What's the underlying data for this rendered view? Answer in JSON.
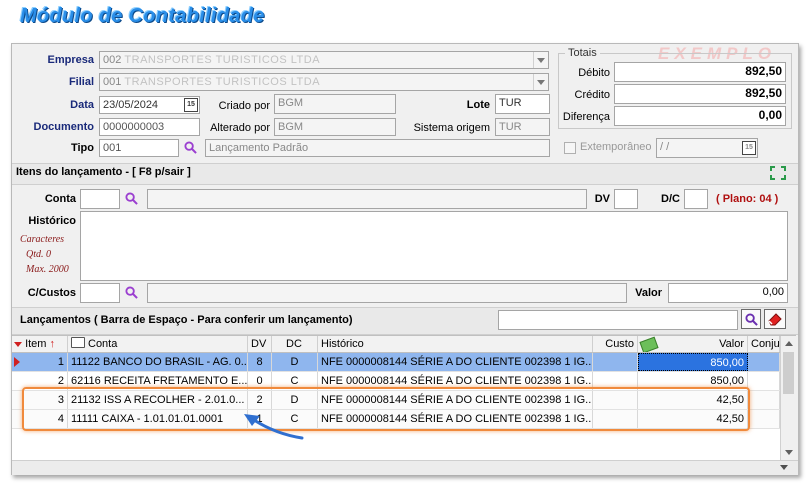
{
  "app": {
    "title": "Módulo de Contabilidade",
    "watermark": "EXEMPLO"
  },
  "header": {
    "empresa": {
      "label": "Empresa",
      "value": "002",
      "masked": "TRANSPORTES TURISTICOS LTDA"
    },
    "filial": {
      "label": "Filial",
      "value": "001",
      "masked": "TRANSPORTES TURISTICOS LTDA"
    },
    "data": {
      "label": "Data",
      "value": "23/05/2024"
    },
    "criado_por": {
      "label": "Criado por",
      "value": "BGM"
    },
    "lote": {
      "label": "Lote",
      "value": "TUR"
    },
    "documento": {
      "label": "Documento",
      "value": "0000000003"
    },
    "alterado_por": {
      "label": "Alterado por",
      "value": "BGM"
    },
    "sistema_origem": {
      "label": "Sistema origem",
      "value": "TUR"
    },
    "tipo": {
      "label": "Tipo",
      "value": "001",
      "descricao": "Lançamento Padrão"
    }
  },
  "totais": {
    "legend": "Totais",
    "debito": {
      "label": "Débito",
      "value": "892,50"
    },
    "credito": {
      "label": "Crédito",
      "value": "892,50"
    },
    "diferenca": {
      "label": "Diferença",
      "value": "0,00"
    }
  },
  "extemporaneo": {
    "label": "Extemporâneo",
    "value": " /  /"
  },
  "itens": {
    "title": "Itens do lançamento - [ F8 p/sair ]",
    "conta_label": "Conta",
    "dv_label": "DV",
    "dc_label": "D/C",
    "plano_label": "( Plano: 04 )",
    "historico_label": "Histórico",
    "caracteres": [
      "Caracteres",
      "Qtd. 0",
      "Max. 2000"
    ],
    "ccustos_label": "C/Custos",
    "valor_label": "Valor",
    "valor_value": "0,00"
  },
  "lancamentos": {
    "title": "Lançamentos ( Barra de Espaço - Para conferir um lançamento)",
    "columns": {
      "item": "Item",
      "conta": "Conta",
      "dv": "DV",
      "dc": "DC",
      "historico": "Histórico",
      "custo": "Custo",
      "valor": "Valor",
      "conju": "Conju"
    },
    "rows": [
      {
        "item": "1",
        "conta": "11122 BANCO DO BRASIL - AG. 0...",
        "dv": "8",
        "dc": "D",
        "historico": "NFE 0000008144 SÉRIE A DO CLIENTE 002398 1 IG...",
        "custo": "",
        "valor": "850,00"
      },
      {
        "item": "2",
        "conta": "62116 RECEITA FRETAMENTO E...",
        "dv": "0",
        "dc": "C",
        "historico": "NFE 0000008144 SÉRIE A DO CLIENTE 002398 1 IG...",
        "custo": "",
        "valor": "850,00"
      },
      {
        "item": "3",
        "conta": "21132 ISS A RECOLHER - 2.01.0...",
        "dv": "2",
        "dc": "D",
        "historico": "NFE 0000008144 SÉRIE A DO CLIENTE 002398 1 IG...",
        "custo": "",
        "valor": "42,50"
      },
      {
        "item": "4",
        "conta": "11111 CAIXA - 1.01.01.01.0001",
        "dv": "1",
        "dc": "C",
        "historico": "NFE 0000008144 SÉRIE A DO CLIENTE 002398 1 IG...",
        "custo": "",
        "valor": "42,50"
      }
    ]
  },
  "colors": {
    "title": "#2a8ee8",
    "label_blue": "#1a2a7a",
    "selected_row": "#8fb6ee",
    "highlight_box": "#f08a3c",
    "plano": "#b01010"
  }
}
